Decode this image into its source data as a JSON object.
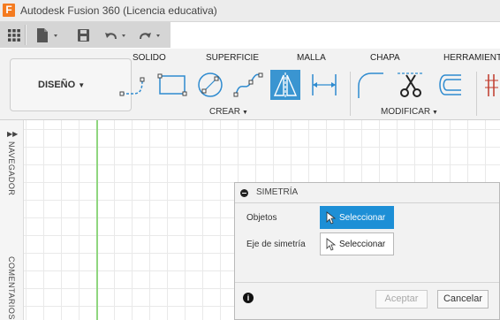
{
  "app": {
    "title": "Autodesk Fusion 360 (Licencia educativa)",
    "logo_letter": "F"
  },
  "ribbon": {
    "tabs": [
      "SOLIDO",
      "SUPERFICIE",
      "MALLA",
      "CHAPA",
      "HERRAMIENTA"
    ],
    "workspace_label": "DISEÑO",
    "groups": {
      "create": "CREAR",
      "modify": "MODIFICAR"
    },
    "accent": "#3a95d1"
  },
  "browser": {
    "navigator": "NAVEGADOR",
    "comments": "COMENTARIOS"
  },
  "dialog": {
    "title": "SIMETRÍA",
    "rows": [
      {
        "label": "Objetos",
        "button": "Seleccionar",
        "active": true
      },
      {
        "label": "Eje de simetría",
        "button": "Seleccionar",
        "active": false
      }
    ],
    "ok_label": "Aceptar",
    "cancel_label": "Cancelar",
    "info_icon": "i"
  }
}
